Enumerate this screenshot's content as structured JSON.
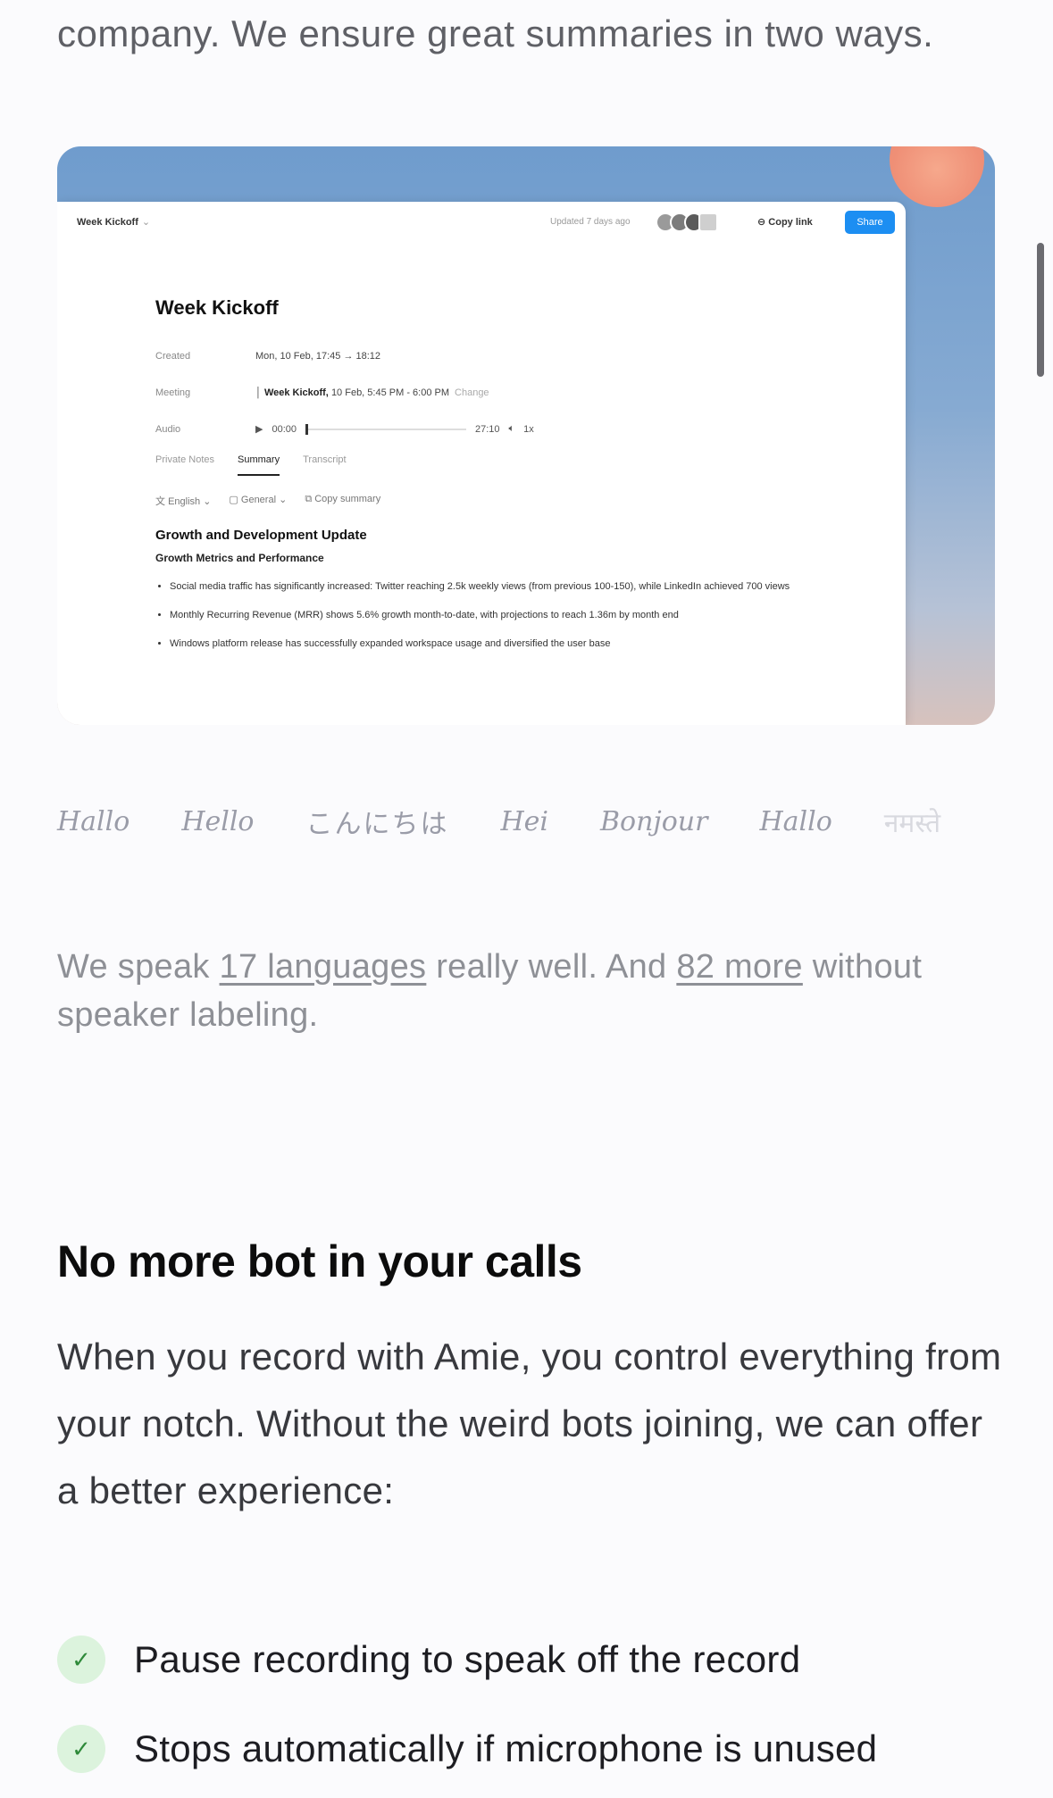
{
  "intro_text": "company. We ensure great summaries in two ways.",
  "app_window": {
    "breadcrumb": "Week Kickoff",
    "updated": "Updated 7 days ago",
    "copy_link": "Copy link",
    "share": "Share",
    "doc_title": "Week Kickoff",
    "meta": {
      "created_label": "Created",
      "created_value": "Mon, 10 Feb, 17:45 → 18:12",
      "meeting_label": "Meeting",
      "meeting_name": "Week Kickoff,",
      "meeting_time": "10 Feb, 5:45 PM - 6:00 PM",
      "meeting_change": "Change",
      "audio_label": "Audio",
      "audio_start": "00:00",
      "audio_end": "27:10",
      "audio_speed": "1x"
    },
    "tabs": [
      "Private Notes",
      "Summary",
      "Transcript"
    ],
    "toolbar": {
      "language": "English",
      "template": "General",
      "copy_summary": "Copy summary"
    },
    "summary_heading": "Growth and Development Update",
    "summary_subheading": "Growth Metrics and Performance",
    "bullets": [
      "Social media traffic has significantly increased: Twitter reaching 2.5k weekly views (from previous 100-150), while LinkedIn achieved 700 views",
      "Monthly Recurring Revenue (MRR) shows 5.6% growth month-to-date, with projections to reach 1.36m by month end",
      "Windows platform release has successfully expanded workspace usage and diversified the user base"
    ]
  },
  "languages": [
    "Hallo",
    "Hello",
    "こんにちは",
    "Hei",
    "Bonjour",
    "Hallo",
    "नमस्ते"
  ],
  "speak": {
    "before": "We speak ",
    "link1": "17 languages",
    "middle": " really well. And ",
    "link2": "82 more",
    "after": " without speaker labeling."
  },
  "section_title": "No more bot in your calls",
  "section_body": "When you record with Amie, you control everything from your notch. Without the weird bots joining, we can offer a better experience:",
  "features": [
    "Pause recording to speak off the record",
    "Stops automatically if microphone is unused"
  ],
  "colors": {
    "accent_blue": "#1c8ef2",
    "check_bg": "#dcf3dd",
    "check_fg": "#2f8a3a"
  }
}
